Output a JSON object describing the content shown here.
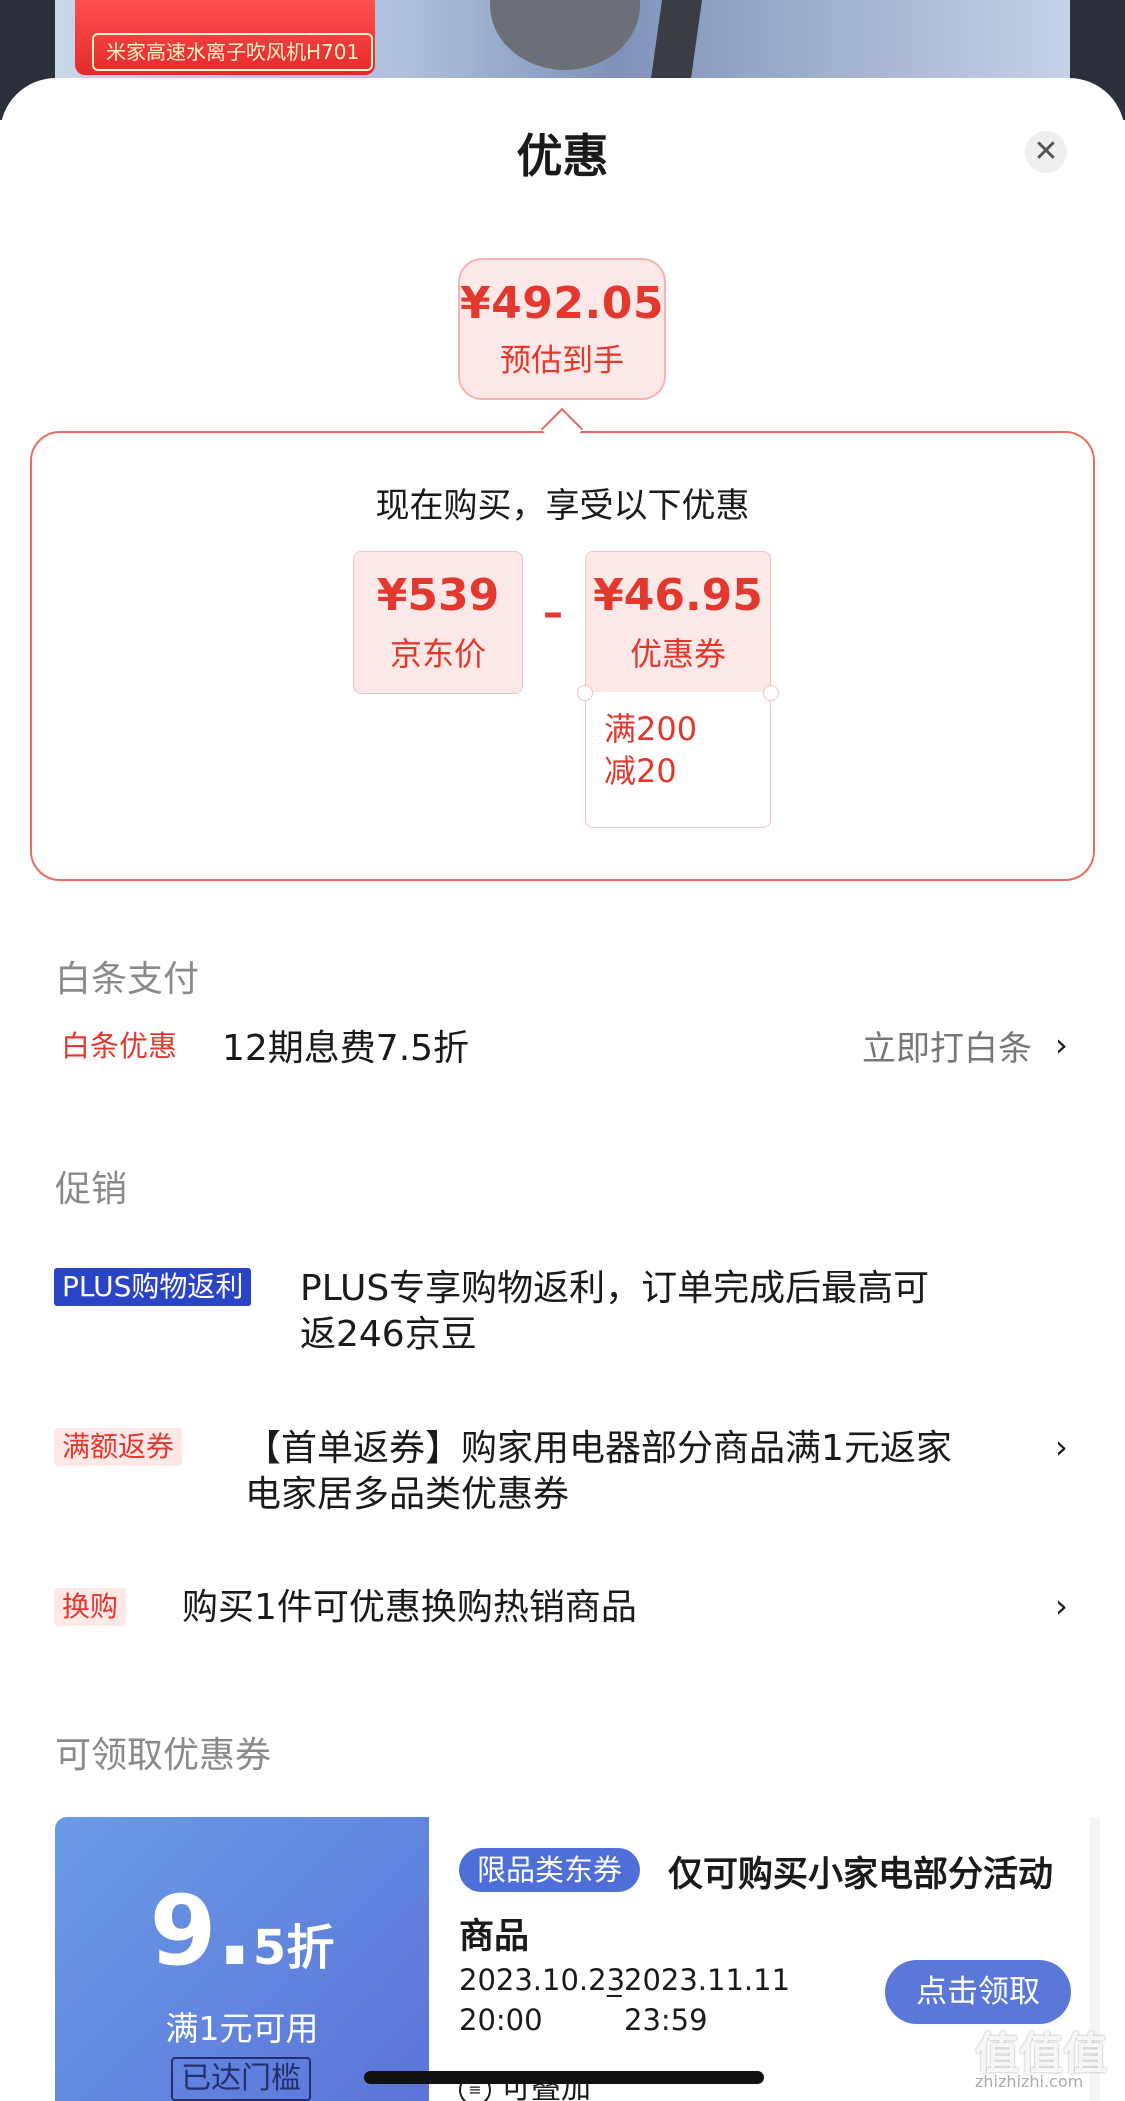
{
  "backdrop": {
    "banner_text": "米家高速水离子吹风机H701"
  },
  "sheet": {
    "title": "优惠"
  },
  "estimate": {
    "price": "¥492.05",
    "label": "预估到手"
  },
  "breakdown": {
    "title": "现在购买，享受以下优惠",
    "jd_price": {
      "value": "¥539",
      "label": "京东价"
    },
    "operator": "–",
    "coupon": {
      "value": "¥46.95",
      "label": "优惠券",
      "rule_line1": "满200",
      "rule_line2": "减20"
    }
  },
  "baitiao": {
    "section_title": "白条支付",
    "tag": "白条优惠",
    "text": "12期息费7.5折",
    "action": "立即打白条",
    "chevron": "›"
  },
  "promotion": {
    "section_title": "促销",
    "items": [
      {
        "tag": "PLUS购物返利",
        "line1": "PLUS专享购物返利，订单完成后最高可",
        "line2": "返246京豆"
      },
      {
        "tag": "满额返券",
        "line1": "【首单返券】购家用电器部分商品满1元返家",
        "line2": "电家居多品类优惠券",
        "chevron": "›"
      },
      {
        "tag": "换购",
        "line1": "购买1件可优惠换购热销商品",
        "chevron": "›"
      }
    ]
  },
  "coupons": {
    "section_title": "可领取优惠券",
    "items": [
      {
        "discount_big": "9.",
        "discount_small": "5折",
        "condition": "满1元可用",
        "status": "已达门槛",
        "tag": "限品类东券",
        "title_line1": "仅可购买小家电部分活动",
        "title_line2": "商品",
        "start_date": "2023.10.23",
        "start_time": "20:00",
        "end_date": "2023.11.11",
        "end_time": "23:59",
        "dash": "_",
        "claim_label": "点击领取",
        "stack_label": "可叠加"
      }
    ]
  },
  "watermark": {
    "main": "值值值",
    "sub": "zhizhizhi.com"
  },
  "icons": {
    "close": "close-icon",
    "chevron": "chevron-right-icon",
    "stack": "stack-icon"
  }
}
